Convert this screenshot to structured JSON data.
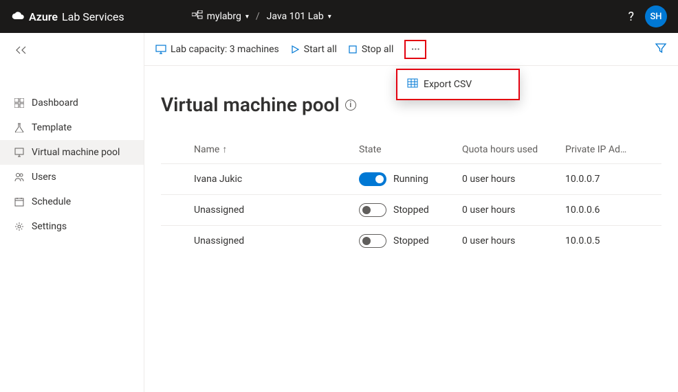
{
  "header": {
    "brand_bold": "Azure",
    "brand_rest": "Lab Services",
    "resource_group": "mylabrg",
    "lab_name": "Java 101 Lab",
    "user_initials": "SH"
  },
  "sidebar": {
    "items": [
      {
        "label": "Dashboard",
        "icon": "dashboard-icon"
      },
      {
        "label": "Template",
        "icon": "flask-icon"
      },
      {
        "label": "Virtual machine pool",
        "icon": "monitor-icon"
      },
      {
        "label": "Users",
        "icon": "users-icon"
      },
      {
        "label": "Schedule",
        "icon": "calendar-icon"
      },
      {
        "label": "Settings",
        "icon": "gear-icon"
      }
    ]
  },
  "toolbar": {
    "capacity_label": "Lab capacity: 3 machines",
    "start_label": "Start all",
    "stop_label": "Stop all",
    "more_dropdown": {
      "export_csv": "Export CSV"
    }
  },
  "page": {
    "title": "Virtual machine pool"
  },
  "table": {
    "columns": {
      "name": "Name",
      "state": "State",
      "quota": "Quota hours used",
      "ip": "Private IP Ad…"
    },
    "rows": [
      {
        "name": "Ivana Jukic",
        "running": true,
        "state_label": "Running",
        "quota": "0 user hours",
        "ip": "10.0.0.7"
      },
      {
        "name": "Unassigned",
        "running": false,
        "state_label": "Stopped",
        "quota": "0 user hours",
        "ip": "10.0.0.6"
      },
      {
        "name": "Unassigned",
        "running": false,
        "state_label": "Stopped",
        "quota": "0 user hours",
        "ip": "10.0.0.5"
      }
    ]
  }
}
